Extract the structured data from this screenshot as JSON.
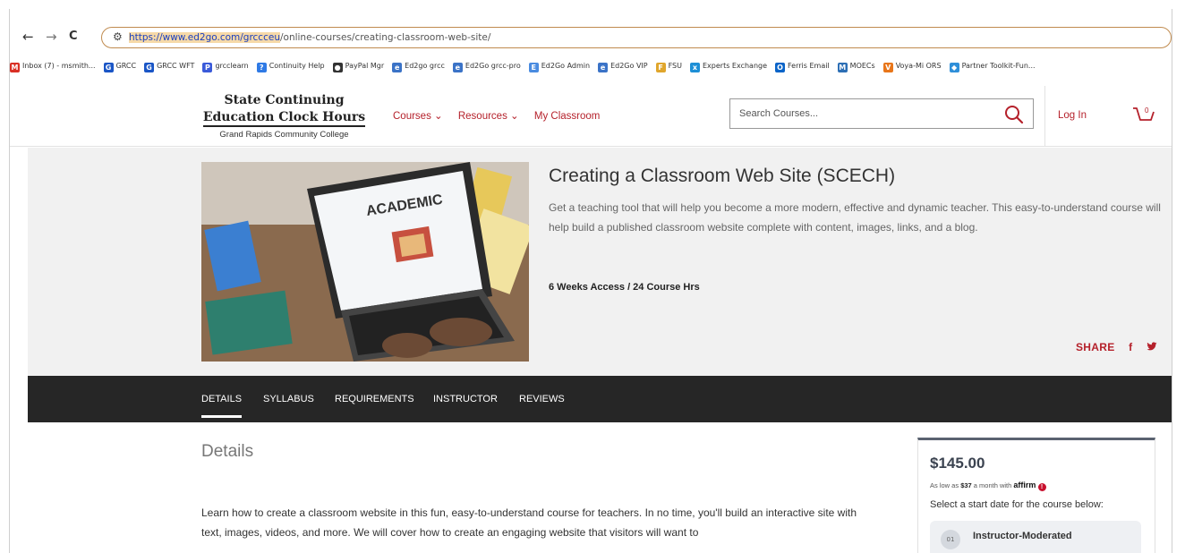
{
  "browser": {
    "back": "←",
    "forward": "→",
    "reload": "C",
    "url_domain": "https://www.ed2go.com/grccceu",
    "url_path": "/online-courses/creating-classroom-web-site/"
  },
  "bookmarks": [
    {
      "label": "Inbox (7) - msmith...",
      "icon": "gmail-icon",
      "color": "#d93025",
      "glyph": "M"
    },
    {
      "label": "GRCC",
      "icon": "google-icon",
      "color": "#1a56c6",
      "glyph": "G"
    },
    {
      "label": "GRCC WFT",
      "icon": "google-icon",
      "color": "#1a56c6",
      "glyph": "G"
    },
    {
      "label": "grcclearn",
      "icon": "p-icon",
      "color": "#3a5ad9",
      "glyph": "P"
    },
    {
      "label": "Continuity Help",
      "icon": "help-icon",
      "color": "#2f7ae5",
      "glyph": "?"
    },
    {
      "label": "PayPal Mgr",
      "icon": "globe-icon",
      "color": "#333333",
      "glyph": "●"
    },
    {
      "label": "Ed2go grcc",
      "icon": "ed2go-icon",
      "color": "#3b73c7",
      "glyph": "e"
    },
    {
      "label": "Ed2Go grcc-pro",
      "icon": "ed2go-icon",
      "color": "#3b73c7",
      "glyph": "e"
    },
    {
      "label": "Ed2Go Admin",
      "icon": "admin-icon",
      "color": "#4a8be0",
      "glyph": "E"
    },
    {
      "label": "Ed2Go VIP",
      "icon": "ed2go-icon",
      "color": "#3b73c7",
      "glyph": "e"
    },
    {
      "label": "FSU",
      "icon": "fsu-icon",
      "color": "#e0a62c",
      "glyph": "F"
    },
    {
      "label": "Experts Exchange",
      "icon": "experts-icon",
      "color": "#1e8fd6",
      "glyph": "x"
    },
    {
      "label": "Ferris Email",
      "icon": "outlook-icon",
      "color": "#0a64c8",
      "glyph": "O"
    },
    {
      "label": "MOECs",
      "icon": "moecs-icon",
      "color": "#2d6fb5",
      "glyph": "M"
    },
    {
      "label": "Voya-Mi ORS",
      "icon": "voya-icon",
      "color": "#e8761a",
      "glyph": "V"
    },
    {
      "label": "Partner Toolkit-Fun...",
      "icon": "toolkit-icon",
      "color": "#2f8fd9",
      "glyph": "◆"
    }
  ],
  "header": {
    "logo_line1": "State Continuing",
    "logo_line2": "Education Clock Hours",
    "logo_line3": "Grand Rapids Community College",
    "nav": [
      "Courses ⌄",
      "Resources ⌄",
      "My Classroom"
    ],
    "search_placeholder": "Search Courses...",
    "login": "Log In",
    "cart_count": "0"
  },
  "hero": {
    "image_text": "ACADEMIC",
    "title": "Creating a Classroom Web Site (SCECH)",
    "description": "Get a teaching tool that will help you become a more modern, effective and dynamic teacher. This easy-to-understand course will help build a published classroom website complete with content, images, links, and a blog.",
    "access": "6 Weeks Access / 24 Course Hrs",
    "share": "SHARE",
    "facebook": "f",
    "twitter": "•"
  },
  "tabs": [
    "DETAILS",
    "SYLLABUS",
    "REQUIREMENTS",
    "INSTRUCTOR",
    "REVIEWS"
  ],
  "details": {
    "heading": "Details",
    "body": "Learn how to create a classroom website in this fun, easy-to-understand course for teachers. In no time, you'll build an interactive site with text, images, videos, and more. We will cover how to create an engaging website that visitors will want to"
  },
  "card": {
    "price": "$145.00",
    "affirm_prefix": "As low as ",
    "affirm_amount": "$37",
    "affirm_suffix": " a month with ",
    "affirm_brand": "affirm",
    "select_text": "Select a start date for the course below:",
    "option_label": "Instructor-Moderated"
  },
  "colors": {
    "accent": "#b5212b",
    "tabbar": "#262626",
    "hero_bg": "#f1f1f1"
  }
}
